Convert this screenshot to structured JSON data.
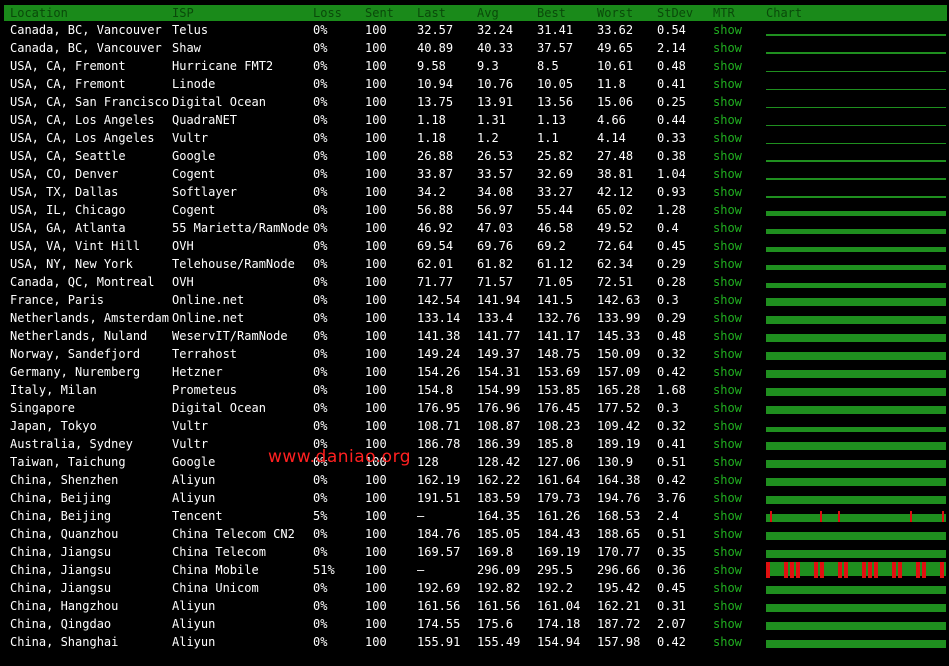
{
  "headers": [
    "Location",
    "ISP",
    "Loss",
    "Sent",
    "Last",
    "Avg",
    "Best",
    "Worst",
    "StDev",
    "MTR",
    "Chart"
  ],
  "watermark": "www.daniao.org",
  "colors": {
    "header_bg": "#1a8a1a",
    "chart_ok": "#1f8f1f",
    "chart_loss": "#e01010",
    "mtr_link": "#20b020"
  },
  "rows": [
    {
      "location": "Canada, BC, Vancouver",
      "isp": "Telus",
      "loss": "0%",
      "sent": "100",
      "last": "32.57",
      "avg": "32.24",
      "best": "31.41",
      "worst": "33.62",
      "stdev": "0.54",
      "mtr": "show",
      "chart": "thin"
    },
    {
      "location": "Canada, BC, Vancouver",
      "isp": "Shaw",
      "loss": "0%",
      "sent": "100",
      "last": "40.89",
      "avg": "40.33",
      "best": "37.57",
      "worst": "49.65",
      "stdev": "2.14",
      "mtr": "show",
      "chart": "thin"
    },
    {
      "location": "USA, CA, Fremont",
      "isp": "Hurricane FMT2",
      "loss": "0%",
      "sent": "100",
      "last": "9.58",
      "avg": "9.3",
      "best": "8.5",
      "worst": "10.61",
      "stdev": "0.48",
      "mtr": "show",
      "chart": "line"
    },
    {
      "location": "USA, CA, Fremont",
      "isp": "Linode",
      "loss": "0%",
      "sent": "100",
      "last": "10.94",
      "avg": "10.76",
      "best": "10.05",
      "worst": "11.8",
      "stdev": "0.41",
      "mtr": "show",
      "chart": "line"
    },
    {
      "location": "USA, CA, San Francisco",
      "isp": "Digital Ocean",
      "loss": "0%",
      "sent": "100",
      "last": "13.75",
      "avg": "13.91",
      "best": "13.56",
      "worst": "15.06",
      "stdev": "0.25",
      "mtr": "show",
      "chart": "line"
    },
    {
      "location": "USA, CA, Los Angeles",
      "isp": "QuadraNET",
      "loss": "0%",
      "sent": "100",
      "last": "1.18",
      "avg": "1.31",
      "best": "1.13",
      "worst": "4.66",
      "stdev": "0.44",
      "mtr": "show",
      "chart": "none"
    },
    {
      "location": "USA, CA, Los Angeles",
      "isp": "Vultr",
      "loss": "0%",
      "sent": "100",
      "last": "1.18",
      "avg": "1.2",
      "best": "1.1",
      "worst": "4.14",
      "stdev": "0.33",
      "mtr": "show",
      "chart": "none"
    },
    {
      "location": "USA, CA, Seattle",
      "isp": "Google",
      "loss": "0%",
      "sent": "100",
      "last": "26.88",
      "avg": "26.53",
      "best": "25.82",
      "worst": "27.48",
      "stdev": "0.38",
      "mtr": "show",
      "chart": "thin"
    },
    {
      "location": "USA, CO, Denver",
      "isp": "Cogent",
      "loss": "0%",
      "sent": "100",
      "last": "33.87",
      "avg": "33.57",
      "best": "32.69",
      "worst": "38.81",
      "stdev": "1.04",
      "mtr": "show",
      "chart": "thin"
    },
    {
      "location": "USA, TX, Dallas",
      "isp": "Softlayer",
      "loss": "0%",
      "sent": "100",
      "last": "34.2",
      "avg": "34.08",
      "best": "33.27",
      "worst": "42.12",
      "stdev": "0.93",
      "mtr": "show",
      "chart": "thin"
    },
    {
      "location": "USA, IL, Chicago",
      "isp": "Cogent",
      "loss": "0%",
      "sent": "100",
      "last": "56.88",
      "avg": "56.97",
      "best": "55.44",
      "worst": "65.02",
      "stdev": "1.28",
      "mtr": "show",
      "chart": "mid"
    },
    {
      "location": "USA, GA, Atlanta",
      "isp": "55 Marietta/RamNode",
      "loss": "0%",
      "sent": "100",
      "last": "46.92",
      "avg": "47.03",
      "best": "46.58",
      "worst": "49.52",
      "stdev": "0.4",
      "mtr": "show",
      "chart": "mid"
    },
    {
      "location": "USA, VA, Vint Hill",
      "isp": "OVH",
      "loss": "0%",
      "sent": "100",
      "last": "69.54",
      "avg": "69.76",
      "best": "69.2",
      "worst": "72.64",
      "stdev": "0.45",
      "mtr": "show",
      "chart": "mid"
    },
    {
      "location": "USA, NY, New York",
      "isp": "Telehouse/RamNode",
      "loss": "0%",
      "sent": "100",
      "last": "62.01",
      "avg": "61.82",
      "best": "61.12",
      "worst": "62.34",
      "stdev": "0.29",
      "mtr": "show",
      "chart": "mid"
    },
    {
      "location": "Canada, QC, Montreal",
      "isp": "OVH",
      "loss": "0%",
      "sent": "100",
      "last": "71.77",
      "avg": "71.57",
      "best": "71.05",
      "worst": "72.51",
      "stdev": "0.28",
      "mtr": "show",
      "chart": "mid"
    },
    {
      "location": "France, Paris",
      "isp": "Online.net",
      "loss": "0%",
      "sent": "100",
      "last": "142.54",
      "avg": "141.94",
      "best": "141.5",
      "worst": "142.63",
      "stdev": "0.3",
      "mtr": "show",
      "chart": "thick"
    },
    {
      "location": "Netherlands, Amsterdam",
      "isp": "Online.net",
      "loss": "0%",
      "sent": "100",
      "last": "133.14",
      "avg": "133.4",
      "best": "132.76",
      "worst": "133.99",
      "stdev": "0.29",
      "mtr": "show",
      "chart": "thick"
    },
    {
      "location": "Netherlands, Nuland",
      "isp": "WeservIT/RamNode",
      "loss": "0%",
      "sent": "100",
      "last": "141.38",
      "avg": "141.77",
      "best": "141.17",
      "worst": "145.33",
      "stdev": "0.48",
      "mtr": "show",
      "chart": "thick"
    },
    {
      "location": "Norway, Sandefjord",
      "isp": "Terrahost",
      "loss": "0%",
      "sent": "100",
      "last": "149.24",
      "avg": "149.37",
      "best": "148.75",
      "worst": "150.09",
      "stdev": "0.32",
      "mtr": "show",
      "chart": "thick"
    },
    {
      "location": "Germany, Nuremberg",
      "isp": "Hetzner",
      "loss": "0%",
      "sent": "100",
      "last": "154.26",
      "avg": "154.31",
      "best": "153.69",
      "worst": "157.09",
      "stdev": "0.42",
      "mtr": "show",
      "chart": "thick"
    },
    {
      "location": "Italy, Milan",
      "isp": "Prometeus",
      "loss": "0%",
      "sent": "100",
      "last": "154.8",
      "avg": "154.99",
      "best": "153.85",
      "worst": "165.28",
      "stdev": "1.68",
      "mtr": "show",
      "chart": "thick"
    },
    {
      "location": "Singapore",
      "isp": "Digital Ocean",
      "loss": "0%",
      "sent": "100",
      "last": "176.95",
      "avg": "176.96",
      "best": "176.45",
      "worst": "177.52",
      "stdev": "0.3",
      "mtr": "show",
      "chart": "thick"
    },
    {
      "location": "Japan, Tokyo",
      "isp": "Vultr",
      "loss": "0%",
      "sent": "100",
      "last": "108.71",
      "avg": "108.87",
      "best": "108.23",
      "worst": "109.42",
      "stdev": "0.32",
      "mtr": "show",
      "chart": "mid"
    },
    {
      "location": "Australia, Sydney",
      "isp": "Vultr",
      "loss": "0%",
      "sent": "100",
      "last": "186.78",
      "avg": "186.39",
      "best": "185.8",
      "worst": "189.19",
      "stdev": "0.41",
      "mtr": "show",
      "chart": "thick"
    },
    {
      "location": "Taiwan, Taichung",
      "isp": "Google",
      "loss": "0%",
      "sent": "100",
      "last": "128",
      "avg": "128.42",
      "best": "127.06",
      "worst": "130.9",
      "stdev": "0.51",
      "mtr": "show",
      "chart": "thick"
    },
    {
      "location": "China, Shenzhen",
      "isp": "Aliyun",
      "loss": "0%",
      "sent": "100",
      "last": "162.19",
      "avg": "162.22",
      "best": "161.64",
      "worst": "164.38",
      "stdev": "0.42",
      "mtr": "show",
      "chart": "thick"
    },
    {
      "location": "China, Beijing",
      "isp": "Aliyun",
      "loss": "0%",
      "sent": "100",
      "last": "191.51",
      "avg": "183.59",
      "best": "179.73",
      "worst": "194.76",
      "stdev": "3.76",
      "mtr": "show",
      "chart": "thick"
    },
    {
      "location": "China, Beijing",
      "isp": "Tencent",
      "loss": "5%",
      "sent": "100",
      "last": "–",
      "avg": "164.35",
      "best": "161.26",
      "worst": "168.53",
      "stdev": "2.4",
      "mtr": "show",
      "chart": "loss5"
    },
    {
      "location": "China, Quanzhou",
      "isp": "China Telecom CN2",
      "loss": "0%",
      "sent": "100",
      "last": "184.76",
      "avg": "185.05",
      "best": "184.43",
      "worst": "188.65",
      "stdev": "0.51",
      "mtr": "show",
      "chart": "thick"
    },
    {
      "location": "China, Jiangsu",
      "isp": "China Telecom",
      "loss": "0%",
      "sent": "100",
      "last": "169.57",
      "avg": "169.8",
      "best": "169.19",
      "worst": "170.77",
      "stdev": "0.35",
      "mtr": "show",
      "chart": "thick"
    },
    {
      "location": "China, Jiangsu",
      "isp": "China Mobile",
      "loss": "51%",
      "sent": "100",
      "last": "–",
      "avg": "296.09",
      "best": "295.5",
      "worst": "296.66",
      "stdev": "0.36",
      "mtr": "show",
      "chart": "loss51"
    },
    {
      "location": "China, Jiangsu",
      "isp": "China Unicom",
      "loss": "0%",
      "sent": "100",
      "last": "192.69",
      "avg": "192.82",
      "best": "192.2",
      "worst": "195.42",
      "stdev": "0.45",
      "mtr": "show",
      "chart": "thick"
    },
    {
      "location": "China, Hangzhou",
      "isp": "Aliyun",
      "loss": "0%",
      "sent": "100",
      "last": "161.56",
      "avg": "161.56",
      "best": "161.04",
      "worst": "162.21",
      "stdev": "0.31",
      "mtr": "show",
      "chart": "thick"
    },
    {
      "location": "China, Qingdao",
      "isp": "Aliyun",
      "loss": "0%",
      "sent": "100",
      "last": "174.55",
      "avg": "175.6",
      "best": "174.18",
      "worst": "187.72",
      "stdev": "2.07",
      "mtr": "show",
      "chart": "thick"
    },
    {
      "location": "China, Shanghai",
      "isp": "Aliyun",
      "loss": "0%",
      "sent": "100",
      "last": "155.91",
      "avg": "155.49",
      "best": "154.94",
      "worst": "157.98",
      "stdev": "0.42",
      "mtr": "show",
      "chart": "thick"
    }
  ]
}
